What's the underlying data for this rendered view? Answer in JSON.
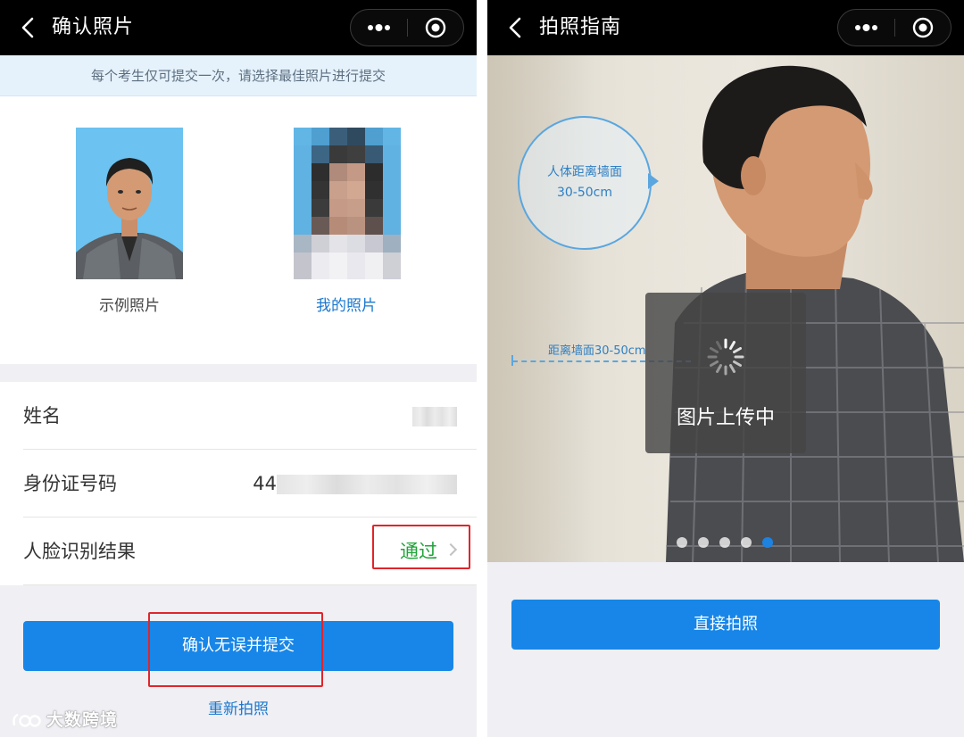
{
  "left": {
    "nav": {
      "title": "确认照片"
    },
    "notice": "每个考生仅可提交一次，请选择最佳照片进行提交",
    "photos": {
      "sample_caption": "示例照片",
      "mine_caption": "我的照片"
    },
    "info": {
      "name_label": "姓名",
      "id_label": "身份证号码",
      "id_prefix": "44",
      "face_label": "人脸识别结果",
      "face_result": "通过"
    },
    "submit_label": "确认无误并提交",
    "retake_label": "重新拍照",
    "watermark": "大数跨境"
  },
  "right": {
    "nav": {
      "title": "拍照指南"
    },
    "bubble": {
      "line1": "人体距离墙面",
      "line2": "30-50cm"
    },
    "distance_label": "距离墙面30-50cm",
    "loading_text": "图片上传中",
    "carousel": {
      "count": 5,
      "active_index": 4
    },
    "direct_label": "直接拍照"
  },
  "colors": {
    "primary": "#1786e8",
    "link": "#1b78cf",
    "success": "#21a43a",
    "highlight": "#e0252b",
    "navbar": "#000000"
  },
  "icons": {
    "back": "chevron-left-icon",
    "more": "more-dots-icon",
    "close": "target-circle-icon",
    "spinner": "loading-spinner-icon"
  }
}
